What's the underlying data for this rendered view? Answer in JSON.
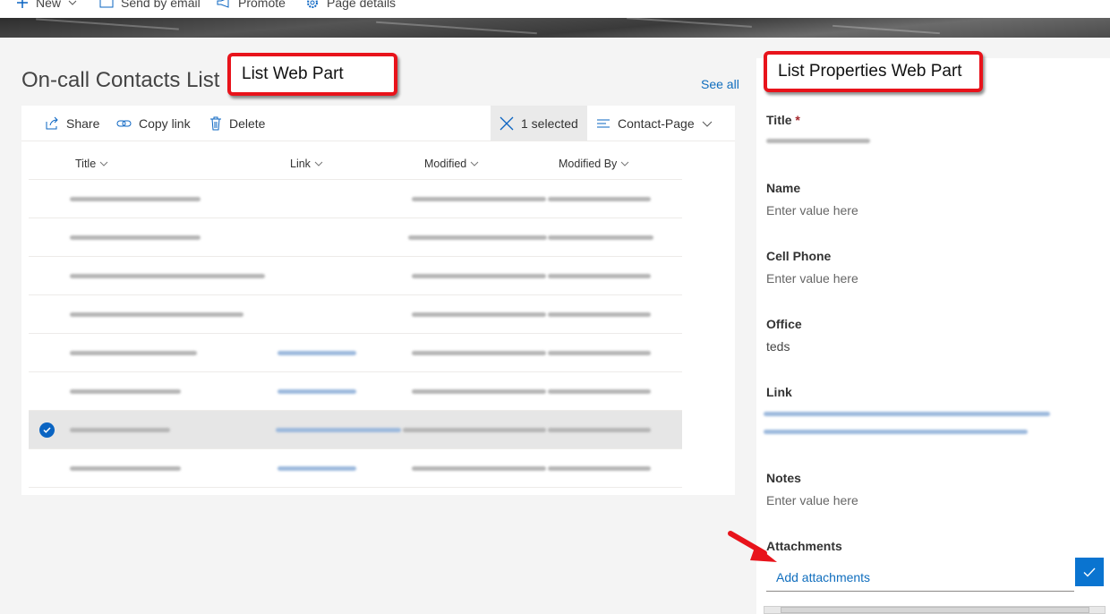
{
  "command_bar": {
    "new_label": "New",
    "email_label": "Send by email",
    "promote_label": "Promote",
    "page_details_label": "Page details"
  },
  "list_web_part": {
    "title": "On-call Contacts List",
    "see_all": "See all",
    "toolbar": {
      "share": "Share",
      "copy_link": "Copy link",
      "delete": "Delete",
      "selected": "1 selected",
      "view_name": "Contact-Page"
    },
    "columns": [
      "Title",
      "Link",
      "Modified",
      "Modified By"
    ],
    "selected_row": 7,
    "row_count": 8
  },
  "callouts": {
    "list": "List Web Part",
    "properties": "List Properties Web Part"
  },
  "properties_panel": {
    "fields": {
      "title_label": "Title",
      "title_required": "*",
      "name_label": "Name",
      "name_value": "Enter value here",
      "cell_label": "Cell Phone",
      "cell_value": "Enter value here",
      "office_label": "Office",
      "office_value": "teds",
      "link_label": "Link",
      "notes_label": "Notes",
      "notes_value": "Enter value here",
      "attachments_label": "Attachments"
    },
    "add_attachments": "Add attachments"
  },
  "colors": {
    "accent": "#0a74d0",
    "link": "#106ebe",
    "callout_border": "#e8131b",
    "selected_row": "#e6e6e6"
  }
}
